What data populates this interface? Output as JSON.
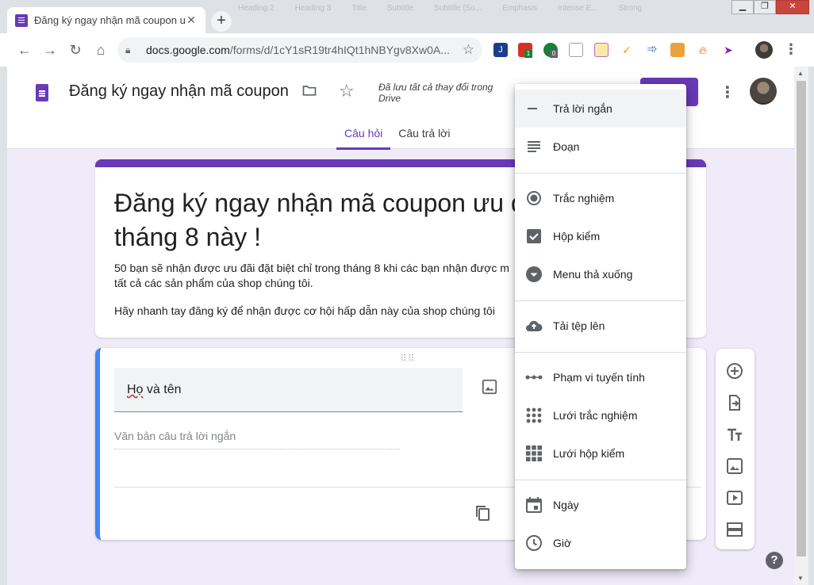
{
  "browser": {
    "tab": {
      "title": "Đăng ký ngay nhận mã coupon ư"
    },
    "background_tabs": [
      "Heading 2",
      "Heading 3",
      "Title",
      "Subtitle",
      "Subtitle (So...",
      "Emphasis",
      "Intense E...",
      "Strong"
    ],
    "url": {
      "host": "docs.google.com",
      "path": "/forms/d/1cY1sR19tr4hIQt1hNBYgv8Xw0A..."
    },
    "extension_badges": {
      "first": "1",
      "second": "0"
    }
  },
  "app": {
    "form_name": "Đăng ký ngay nhận mã coupon ư",
    "saved_status": "Đã lưu tất cả thay đổi trong Drive",
    "tabs": [
      {
        "label": "Câu hỏi",
        "active": true
      },
      {
        "label": "Câu trả lời",
        "active": false
      }
    ],
    "accent": "#673ab7"
  },
  "form": {
    "title_line1": "Đăng ký ngay nhận mã coupon ưu đ",
    "title_line2": "tháng 8 này !",
    "description_line1": "50 bạn sẽ nhận được ưu đãi đặt biệt chỉ trong tháng 8 khi các bạn nhận được m",
    "description_line2": "tất cả các sản phẩm của shop chúng tôi.",
    "description_line3": "Hãy nhanh tay đăng ký để nhận được cơ hội hấp dẫn này của shop chúng tôi",
    "question": {
      "title_first": "Họ",
      "title_rest": " và tên",
      "answer_placeholder": "Văn bản câu trả lời ngắn"
    }
  },
  "menu": {
    "items": [
      {
        "label": "Trả lời ngắn",
        "icon": "short-answer-icon",
        "selected": true
      },
      {
        "label": "Đoạn",
        "icon": "paragraph-icon"
      },
      {
        "label": "Trắc nghiệm",
        "icon": "radio-button-icon"
      },
      {
        "label": "Hộp kiểm",
        "icon": "checkbox-icon"
      },
      {
        "label": "Menu thả xuống",
        "icon": "dropdown-icon"
      },
      {
        "label": "Tải tệp lên",
        "icon": "cloud-upload-icon"
      },
      {
        "label": "Phạm vi tuyến tính",
        "icon": "linear-scale-icon"
      },
      {
        "label": "Lưới trắc nghiệm",
        "icon": "grid-dots-icon"
      },
      {
        "label": "Lưới hộp kiểm",
        "icon": "grid-squares-icon"
      },
      {
        "label": "Ngày",
        "icon": "calendar-icon"
      },
      {
        "label": "Giờ",
        "icon": "clock-icon"
      }
    ]
  },
  "help": {
    "label": "?"
  }
}
